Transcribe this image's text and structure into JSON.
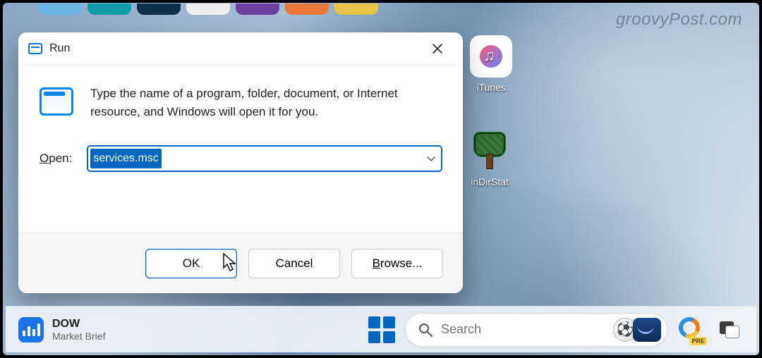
{
  "watermark": "groovyPost.com",
  "desktop": {
    "icons": [
      {
        "name": "itunes",
        "label": "iTunes"
      },
      {
        "name": "windirstat",
        "label": "inDirStat"
      }
    ]
  },
  "run_dialog": {
    "title": "Run",
    "description": "Type the name of a program, folder, document, or Internet resource, and Windows will open it for you.",
    "open_label_underline": "O",
    "open_label_rest": "pen:",
    "input_value": "services.msc",
    "buttons": {
      "ok": "OK",
      "cancel": "Cancel",
      "browse_underline": "B",
      "browse_rest": "rowse..."
    }
  },
  "taskbar": {
    "widget_title": "DOW",
    "widget_subtitle": "Market Brief",
    "search_placeholder": "Search",
    "outlook_badge": "PRE"
  }
}
